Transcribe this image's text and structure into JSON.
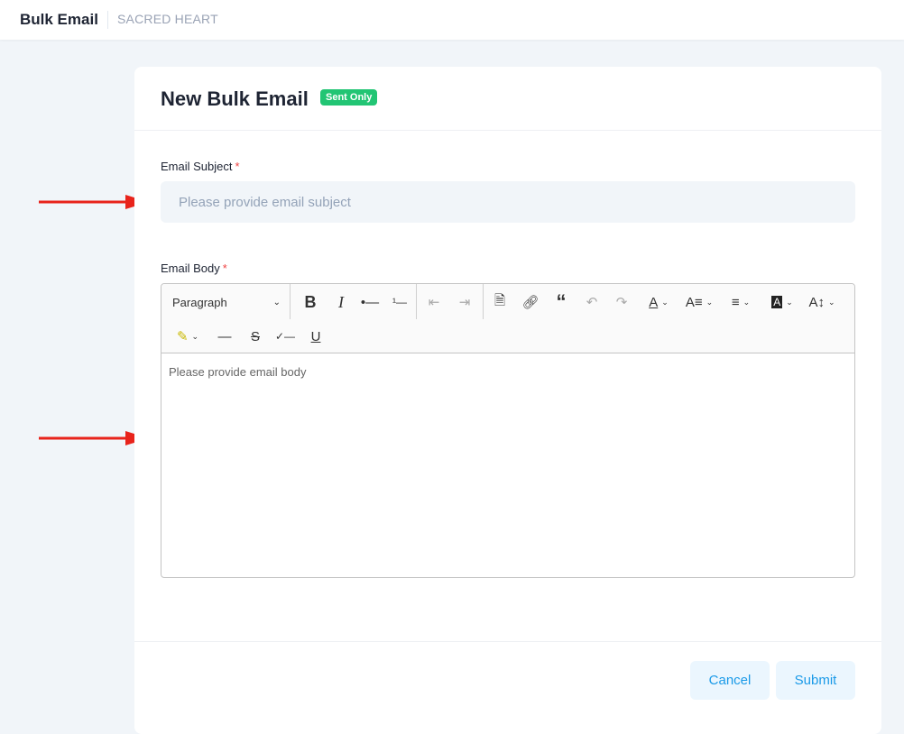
{
  "topbar": {
    "title": "Bulk Email",
    "organization": "SACRED HEART"
  },
  "card": {
    "title": "New Bulk Email",
    "badge": "Sent Only"
  },
  "subject": {
    "label": "Email Subject",
    "required": "*",
    "placeholder": "Please provide email subject",
    "value": ""
  },
  "body": {
    "label": "Email Body",
    "required": "*",
    "placeholder": "Please provide email body"
  },
  "toolbar": {
    "heading_select": "Paragraph",
    "bold": "B",
    "italic": "I"
  },
  "footer": {
    "cancel": "Cancel",
    "submit": "Submit"
  },
  "colors": {
    "accent": "#1a9ae8",
    "badge": "#22c574",
    "arrow": "#e8231b"
  }
}
